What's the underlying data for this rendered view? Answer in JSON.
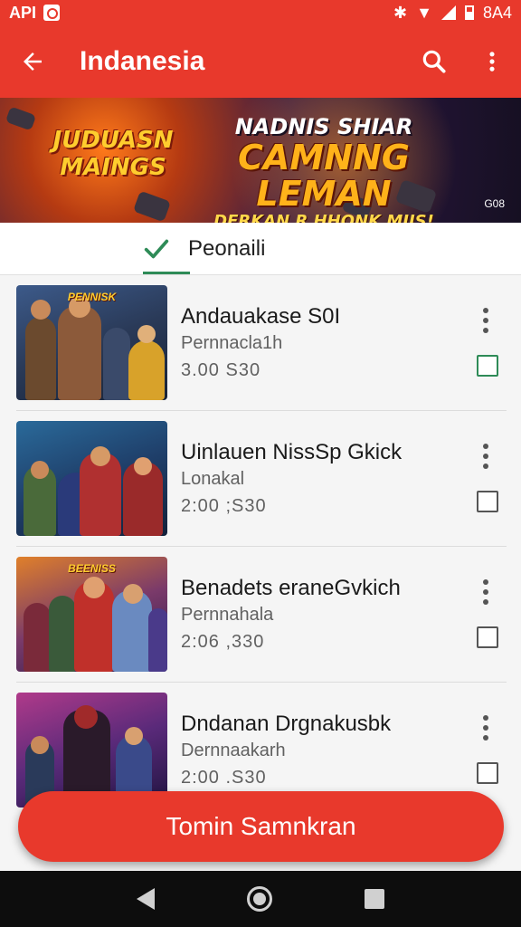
{
  "status_bar": {
    "left_text": "API",
    "right_text": "8A4"
  },
  "app_bar": {
    "title": "Indanesia",
    "back_icon": "arrow-back-icon",
    "search_icon": "search-icon",
    "menu_icon": "more-vert-icon"
  },
  "banner": {
    "left_line1": "JUDUASN",
    "left_line2": "MAINGS",
    "right_line1": "NADNIS SHIAR",
    "right_line2": "CAMNNG LEMAN",
    "right_line3": "DERKAN R HHONK MIIS!",
    "badge": "G08"
  },
  "tab": {
    "label": "Peonaili",
    "icon": "check-icon"
  },
  "items": [
    {
      "title": "Andauakase S0I",
      "subtitle": "Pernnacla1h",
      "price": "3.00  S30",
      "thumb_label": "PENNISK",
      "checkbox_color": "#2e8b57"
    },
    {
      "title": "Uinlauen NissSp Gkick",
      "subtitle": "Lonakal",
      "price": "2:00 ;S30",
      "thumb_label": "",
      "checkbox_color": "#555555"
    },
    {
      "title": "Benadets eraneGvkich",
      "subtitle": "Pernnahala",
      "price": "2:06 ,330",
      "thumb_label": "BEENISS",
      "checkbox_color": "#555555"
    },
    {
      "title": "Dndanan Drgnakusbk",
      "subtitle": "Dernnaakarh",
      "price": "2:00 .S30",
      "thumb_label": "",
      "checkbox_color": "#555555"
    }
  ],
  "cta": {
    "label": "Tomin Samnkran"
  },
  "colors": {
    "primary": "#e8392c",
    "accent": "#2e8b57"
  },
  "nav": {
    "back_icon": "nav-back-icon",
    "home_icon": "nav-home-icon",
    "recent_icon": "nav-recents-icon"
  }
}
